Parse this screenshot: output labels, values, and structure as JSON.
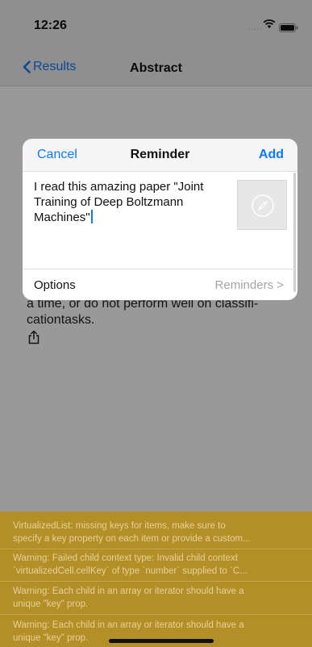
{
  "status": {
    "time": "12:26",
    "signal": "....."
  },
  "nav": {
    "back_label": "Results",
    "title": "Abstract"
  },
  "content": {
    "text_lines": [
      "a time, or do not perform well on classifi-",
      "cationtasks."
    ]
  },
  "dialog": {
    "cancel_label": "Cancel",
    "title": "Reminder",
    "add_label": "Add",
    "message_lines": [
      "I read this amazing paper \"Joint",
      "Training of Deep Boltzmann",
      "Machines\""
    ],
    "options_label": "Options",
    "options_value": "Reminders >"
  },
  "warnings": [
    [
      "VirtualizedList: missing keys for items, make sure to",
      "specify a key property on each item or provide a custom..."
    ],
    [
      "Warning: Failed child context type: Invalid child context",
      "`virtualizedCell.cellKey` of type `number` supplied to `C..."
    ],
    [
      "Warning: Each child in an array or iterator should have a",
      "unique \"key\" prop."
    ],
    [
      "Warning: Each child in an array or iterator should have a",
      "unique \"key\" prop."
    ]
  ],
  "colors": {
    "accent": "#0a7aff",
    "warning_bg": "#b48f28"
  }
}
